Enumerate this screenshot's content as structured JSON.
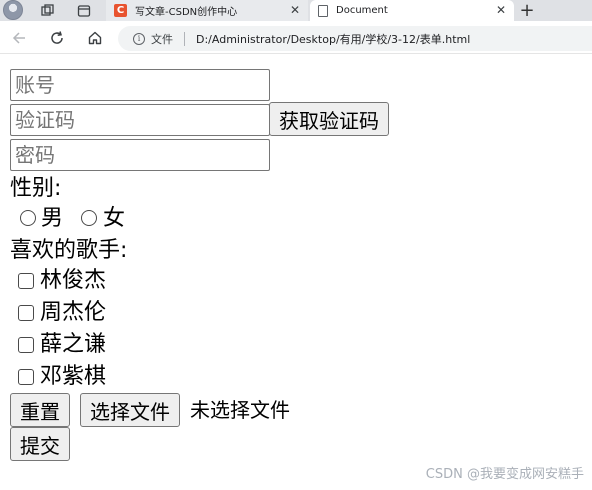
{
  "browser": {
    "tabs": [
      {
        "title": "写文章-CSDN创作中心",
        "favicon": "C",
        "active": false
      },
      {
        "title": "Document",
        "active": true
      }
    ],
    "new_tab": "+",
    "close_glyph": "✕",
    "address": {
      "security_label": "文件",
      "url": "D:/Administrator/Desktop/有用/学校/3-12/表单.html"
    }
  },
  "form": {
    "account_placeholder": "账号",
    "captcha_placeholder": "验证码",
    "captcha_button": "获取验证码",
    "password_placeholder": "密码",
    "gender_label": "性别:",
    "gender_options": [
      "男",
      "女"
    ],
    "singer_label": "喜欢的歌手:",
    "singers": [
      "林俊杰",
      "周杰伦",
      "薛之谦",
      "邓紫棋"
    ],
    "reset_button": "重置",
    "file_button": "选择文件",
    "file_status": "未选择文件",
    "submit_button": "提交"
  },
  "watermark": "CSDN @我要变成网安糕手",
  "colors": {
    "tabstrip": "#dfe1e5",
    "csdn_brand": "#e8532f",
    "button_bg": "#efefef",
    "border": "#767676"
  }
}
